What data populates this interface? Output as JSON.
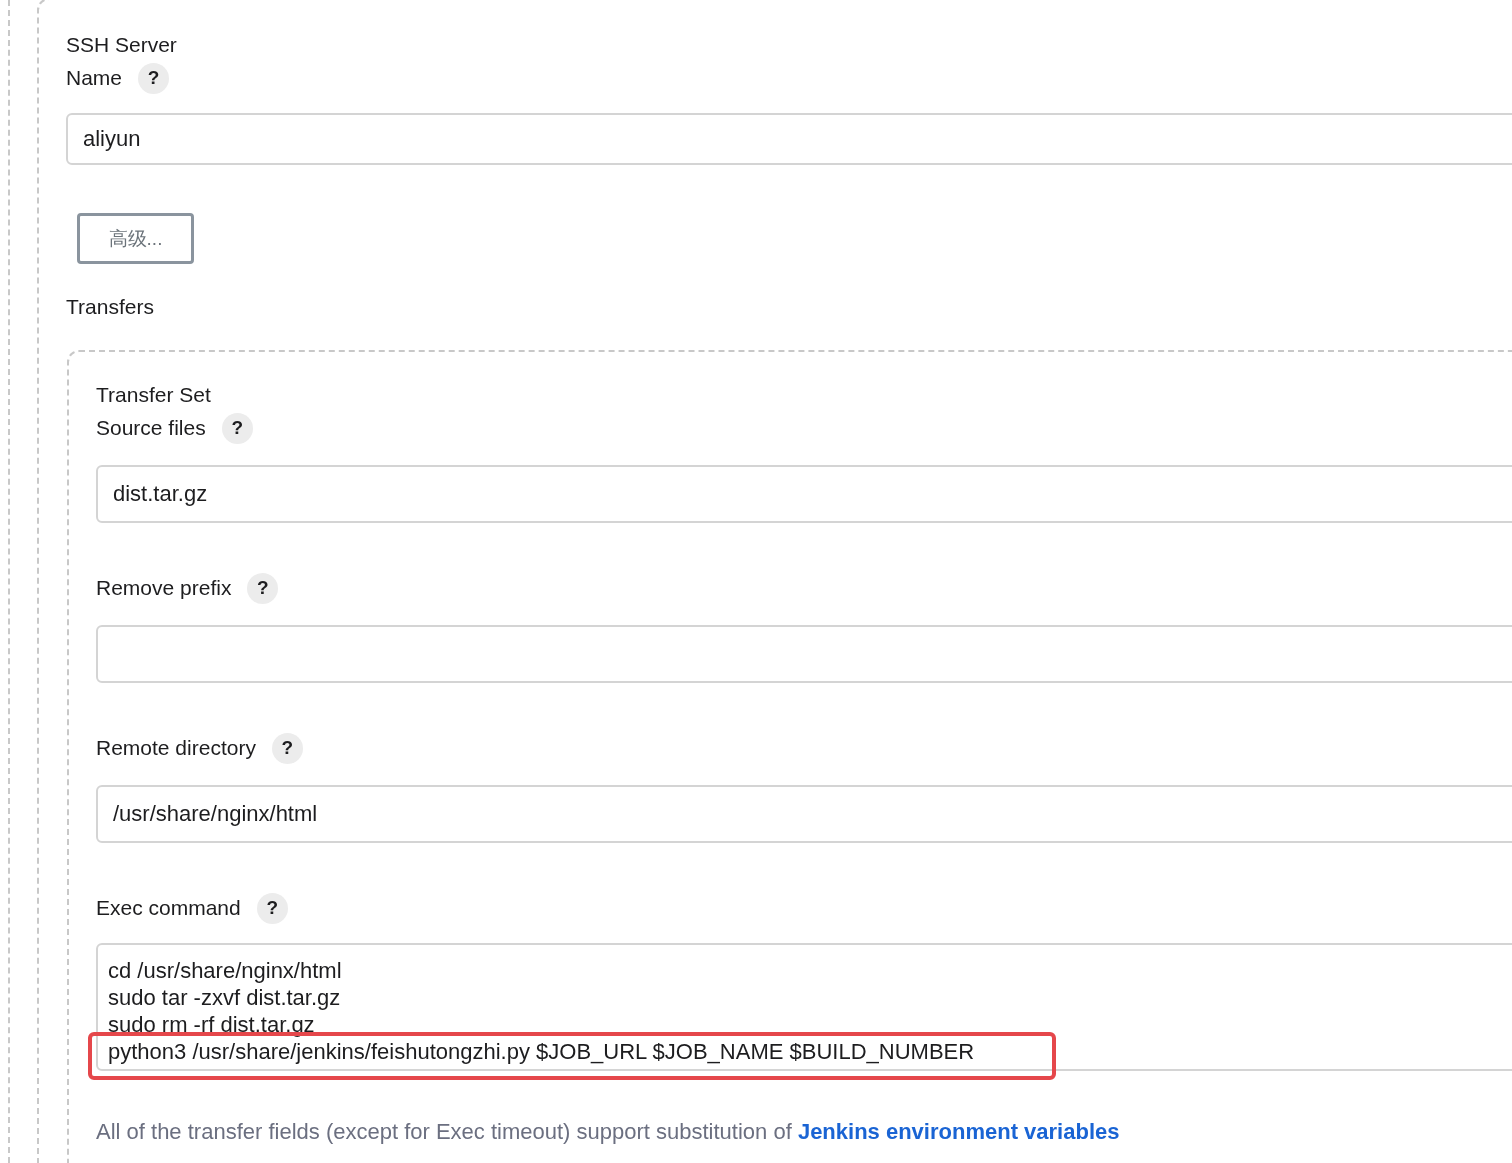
{
  "server": {
    "heading": "SSH Server",
    "name_label": "Name",
    "name_help": "?",
    "name_value": "aliyun",
    "advanced_button": "高级...",
    "transfers_label": "Transfers"
  },
  "transfer_set": {
    "heading": "Transfer Set",
    "fields": [
      {
        "label": "Source files",
        "help": "?",
        "value": "dist.tar.gz"
      },
      {
        "label": "Remove prefix",
        "help": "?"
      },
      {
        "label": "Remote directory",
        "help": "?",
        "value": "/usr/share/nginx/html"
      }
    ],
    "exec_command": {
      "label": "Exec command",
      "help": "?",
      "lines": [
        {
          "text": "cd /usr/share/nginx/html",
          "highlighted": false
        },
        {
          "text": "sudo tar -zxvf dist.tar.gz",
          "highlighted": false
        },
        {
          "text": "sudo rm -rf dist.tar.gz",
          "highlighted": false
        },
        {
          "text": "python3 /usr/share/jenkins/feishutongzhi.py $JOB_URL $JOB_NAME $BUILD_NUMBER",
          "highlighted": true
        }
      ]
    },
    "footnote": "All of the transfer fields (except for Exec timeout) support substitution of",
    "footnote_link": "Jenkins environment variables"
  }
}
